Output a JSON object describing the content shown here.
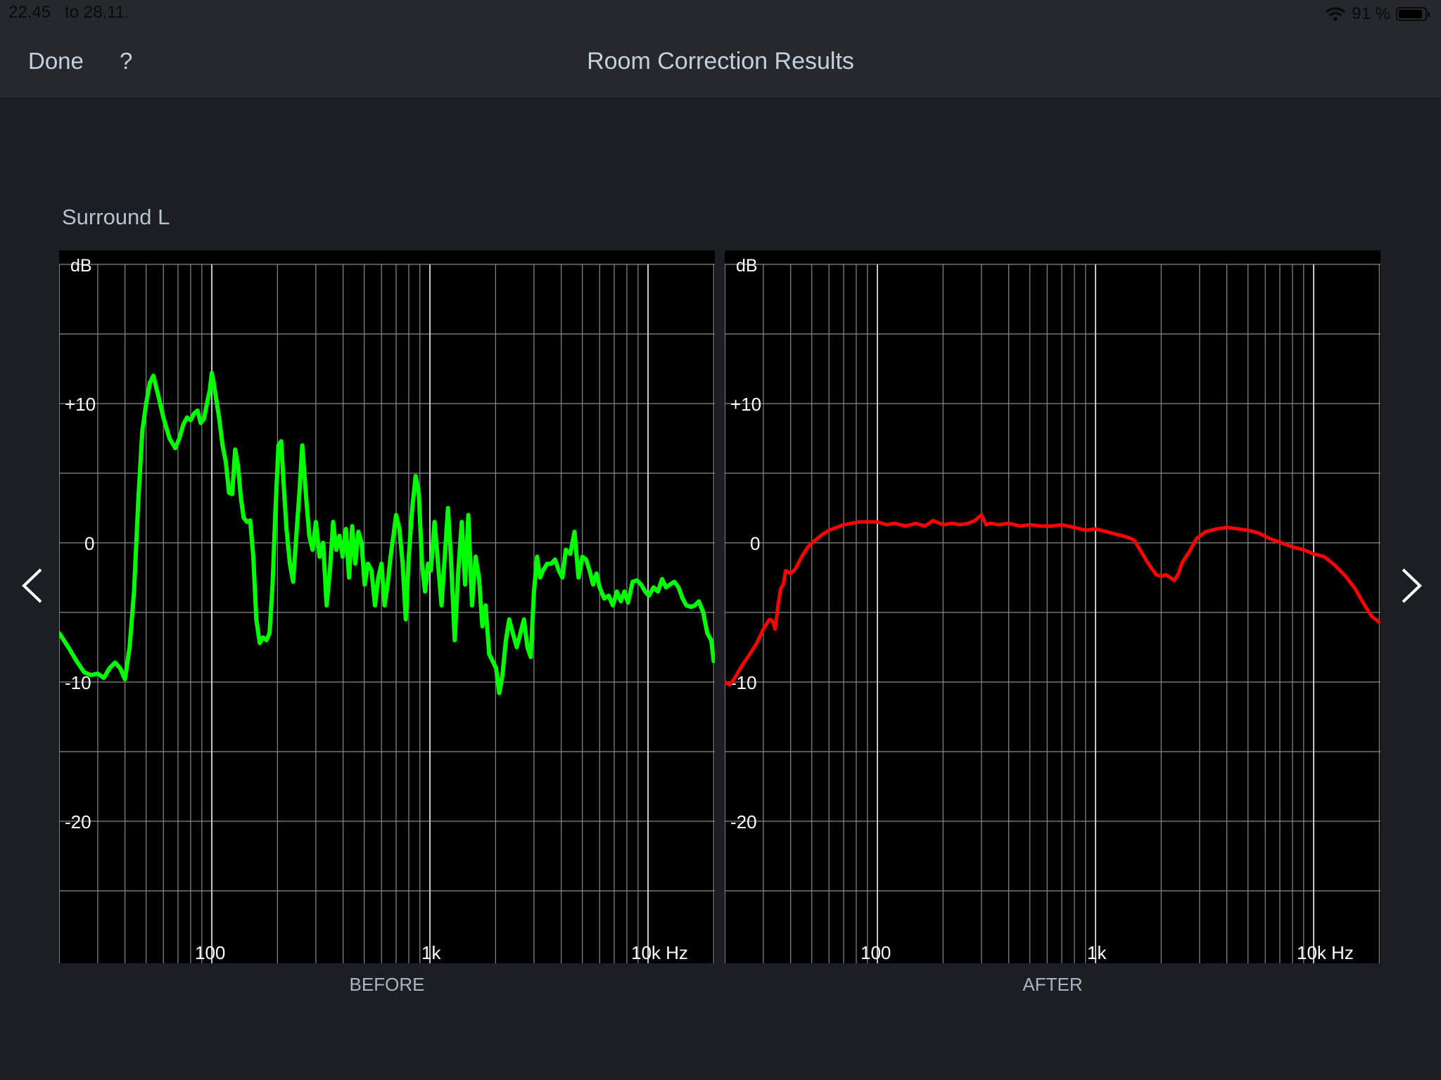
{
  "status_bar": {
    "time": "22.45",
    "date": "to 28.11.",
    "battery_percent": "91 %",
    "battery_level": 0.91
  },
  "nav": {
    "done_label": "Done",
    "help_label": "?",
    "title": "Room Correction Results"
  },
  "speaker": "Surround L",
  "icons": {
    "prev": "chevron-left-icon",
    "next": "chevron-right-icon",
    "wifi": "wifi-icon",
    "battery": "battery-icon"
  },
  "chart_data": [
    {
      "type": "line",
      "title": "BEFORE",
      "xlabel": "Hz",
      "ylabel": "dB",
      "xscale": "log",
      "xlim": [
        20,
        20000
      ],
      "ylim": [
        -30,
        22
      ],
      "grid": true,
      "line_color": "#00ff00",
      "y_ticks": [
        {
          "value": 10,
          "label": "+10"
        },
        {
          "value": 0,
          "label": "0"
        },
        {
          "value": -10,
          "label": "-10"
        },
        {
          "value": -20,
          "label": "-20"
        }
      ],
      "x_ticks": [
        {
          "value": 100,
          "label": "100"
        },
        {
          "value": 1000,
          "label": "1k"
        },
        {
          "value": 10000,
          "label": "10k Hz"
        }
      ],
      "unit_label": "dB",
      "series": [
        {
          "name": "Surround L before",
          "x": [
            20,
            22,
            24,
            26,
            28,
            30,
            32,
            34,
            36,
            38,
            40,
            42,
            44,
            46,
            48,
            50,
            52,
            54,
            57,
            60,
            64,
            68,
            71,
            74,
            77,
            80,
            83,
            86,
            89,
            92,
            95,
            98,
            100,
            102,
            105,
            108,
            112,
            116,
            120,
            124,
            128,
            132,
            136,
            140,
            145,
            150,
            155,
            160,
            166,
            172,
            178,
            184,
            190,
            196,
            202,
            208,
            214,
            220,
            228,
            236,
            244,
            252,
            260,
            270,
            280,
            290,
            300,
            312,
            324,
            336,
            348,
            360,
            372,
            385,
            398,
            412,
            426,
            440,
            455,
            470,
            486,
            502,
            520,
            540,
            560,
            580,
            600,
            620,
            640,
            660,
            680,
            700,
            725,
            750,
            775,
            800,
            830,
            860,
            890,
            920,
            950,
            980,
            1010,
            1050,
            1090,
            1130,
            1170,
            1210,
            1250,
            1300,
            1350,
            1400,
            1450,
            1500,
            1560,
            1620,
            1680,
            1740,
            1800,
            1870,
            1940,
            2010,
            2080,
            2150,
            2230,
            2310,
            2400,
            2500,
            2600,
            2700,
            2800,
            2900,
            3000,
            3100,
            3200,
            3300,
            3450,
            3600,
            3750,
            3900,
            4050,
            4200,
            4400,
            4600,
            4800,
            5000,
            5200,
            5400,
            5600,
            5800,
            6000,
            6300,
            6600,
            6900,
            7200,
            7500,
            7800,
            8100,
            8500,
            8900,
            9300,
            9700,
            10100,
            10600,
            11100,
            11600,
            12100,
            12600,
            13200,
            13800,
            14400,
            15000,
            15700,
            16400,
            17100,
            17900,
            18700,
            19500,
            20000
          ],
          "y": [
            -6.5,
            -7.5,
            -8.5,
            -9.3,
            -9.5,
            -9.4,
            -9.7,
            -9.0,
            -8.6,
            -9.0,
            -9.8,
            -7.5,
            -3.5,
            3.0,
            8.0,
            10.0,
            11.5,
            12.0,
            10.5,
            9.0,
            7.5,
            6.8,
            7.5,
            8.5,
            9.0,
            8.8,
            9.3,
            9.5,
            8.6,
            8.9,
            10.0,
            11.0,
            12.2,
            11.5,
            10.2,
            9.0,
            7.0,
            5.8,
            3.6,
            3.5,
            6.7,
            5.5,
            3.2,
            1.8,
            1.5,
            1.6,
            -1.0,
            -5.5,
            -7.2,
            -6.8,
            -7.0,
            -6.5,
            -3.0,
            2.5,
            7.0,
            7.3,
            4.0,
            1.0,
            -1.5,
            -2.8,
            0.5,
            3.5,
            7.0,
            3.5,
            0.5,
            -0.5,
            1.5,
            -1.0,
            0.0,
            -4.5,
            -2.0,
            1.5,
            -0.5,
            0.5,
            -1.0,
            1.0,
            -2.5,
            1.2,
            -1.5,
            0.8,
            0.0,
            -3.0,
            -1.5,
            -2.0,
            -4.5,
            -2.5,
            -1.5,
            -4.5,
            -3.0,
            -1.0,
            0.5,
            2.0,
            1.0,
            -1.5,
            -5.5,
            -1.0,
            2.5,
            4.8,
            3.5,
            -1.5,
            -3.5,
            -1.5,
            -2.0,
            1.5,
            -1.5,
            -4.5,
            -1.0,
            2.5,
            -1.2,
            -7.0,
            -2.0,
            1.5,
            -3.0,
            2.0,
            -4.5,
            -1.0,
            -2.5,
            -6.0,
            -4.5,
            -8.0,
            -8.5,
            -9.0,
            -10.8,
            -9.5,
            -7.0,
            -5.5,
            -6.5,
            -7.5,
            -6.5,
            -5.5,
            -7.5,
            -8.2,
            -3.5,
            -1.0,
            -2.5,
            -2.0,
            -1.5,
            -1.5,
            -1.2,
            -2.0,
            -2.5,
            -0.5,
            -0.8,
            0.8,
            -2.5,
            -1.0,
            -1.2,
            -2.0,
            -3.0,
            -2.2,
            -3.2,
            -4.0,
            -3.8,
            -4.5,
            -3.5,
            -4.2,
            -3.5,
            -4.3,
            -2.8,
            -2.7,
            -3.0,
            -3.5,
            -3.8,
            -3.2,
            -3.5,
            -2.6,
            -3.2,
            -3.0,
            -2.8,
            -3.2,
            -4.0,
            -4.5,
            -4.6,
            -4.5,
            -4.2,
            -5.0,
            -6.5,
            -7.0,
            -8.5,
            -9.5,
            -10.5
          ]
        }
      ]
    },
    {
      "type": "line",
      "title": "AFTER",
      "xlabel": "Hz",
      "ylabel": "dB",
      "xscale": "log",
      "xlim": [
        20,
        20000
      ],
      "ylim": [
        -30,
        22
      ],
      "grid": true,
      "line_color": "#ff0000",
      "y_ticks": [
        {
          "value": 10,
          "label": "+10"
        },
        {
          "value": 0,
          "label": "0"
        },
        {
          "value": -10,
          "label": "-10"
        },
        {
          "value": -20,
          "label": "-20"
        }
      ],
      "x_ticks": [
        {
          "value": 100,
          "label": "100"
        },
        {
          "value": 1000,
          "label": "1k"
        },
        {
          "value": 10000,
          "label": "10k Hz"
        }
      ],
      "unit_label": "dB",
      "series": [
        {
          "name": "Surround L after",
          "x": [
            20,
            21,
            22,
            24,
            26,
            28,
            30,
            32,
            33,
            34,
            35,
            36,
            37,
            38,
            40,
            42,
            45,
            48,
            52,
            56,
            60,
            65,
            70,
            76,
            82,
            90,
            100,
            110,
            120,
            135,
            150,
            165,
            180,
            200,
            220,
            240,
            260,
            280,
            300,
            315,
            330,
            360,
            400,
            450,
            500,
            560,
            630,
            700,
            800,
            900,
            1000,
            1120,
            1250,
            1400,
            1500,
            1600,
            1700,
            1800,
            1900,
            2000,
            2100,
            2200,
            2300,
            2400,
            2500,
            2700,
            2900,
            3200,
            3600,
            4000,
            4500,
            5000,
            5600,
            6300,
            7100,
            8000,
            9000,
            10000,
            11200,
            12500,
            14000,
            15500,
            17000,
            18500,
            20000
          ],
          "y": [
            -10.0,
            -10.2,
            -9.8,
            -8.8,
            -8.0,
            -7.2,
            -6.2,
            -5.5,
            -5.6,
            -6.2,
            -4.5,
            -3.3,
            -3.0,
            -2.0,
            -2.2,
            -1.9,
            -1.0,
            -0.3,
            0.2,
            0.6,
            0.9,
            1.1,
            1.3,
            1.4,
            1.5,
            1.5,
            1.5,
            1.3,
            1.4,
            1.2,
            1.4,
            1.2,
            1.6,
            1.3,
            1.4,
            1.3,
            1.4,
            1.6,
            2.0,
            1.3,
            1.4,
            1.3,
            1.4,
            1.2,
            1.3,
            1.2,
            1.2,
            1.3,
            1.1,
            0.9,
            1.0,
            0.8,
            0.6,
            0.4,
            0.2,
            -0.5,
            -1.2,
            -1.8,
            -2.3,
            -2.4,
            -2.3,
            -2.5,
            -2.7,
            -2.2,
            -1.4,
            -0.6,
            0.3,
            0.8,
            1.0,
            1.1,
            1.0,
            0.9,
            0.7,
            0.3,
            0.0,
            -0.3,
            -0.5,
            -0.8,
            -1.0,
            -1.6,
            -2.4,
            -3.3,
            -4.4,
            -5.3,
            -5.7
          ]
        }
      ]
    }
  ],
  "captions": {
    "before": "BEFORE",
    "after": "AFTER"
  }
}
